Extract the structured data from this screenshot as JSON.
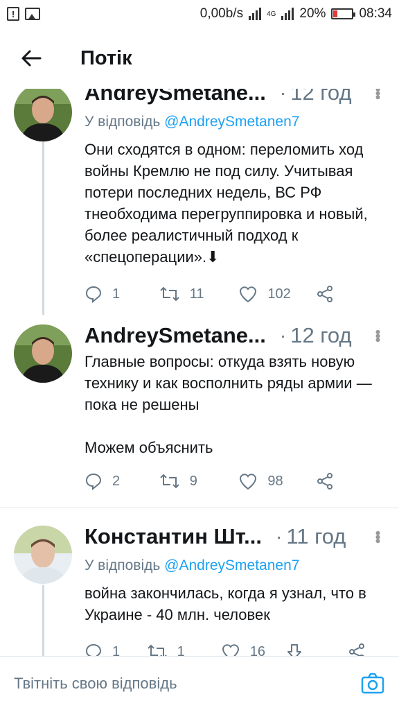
{
  "status_bar": {
    "speed": "0,00b/s",
    "network": "4G",
    "battery": "20%",
    "time": "08:34"
  },
  "header": {
    "title": "Потік"
  },
  "tweets": [
    {
      "name": "AndreySmetane...",
      "separator": "·",
      "time": "12 год",
      "reply_prefix": "У відповідь",
      "reply_handle": "@AndreySmetanen7",
      "text": "Они сходятся в одном: переломить ход войны Кремлю не под силу. Учитывая потери последних недель, ВС РФ тнеобходима перегруппировка и новый, более реалистичный подход к «спецоперации».⬇",
      "replies": "1",
      "retweets": "11",
      "likes": "102"
    },
    {
      "name": "AndreySmetane...",
      "separator": "·",
      "time": "12 год",
      "text": "Главные вопросы: откуда взять новую технику и как восполнить ряды армии — пока не решены\n\nМожем объяснить",
      "replies": "2",
      "retweets": "9",
      "likes": "98"
    },
    {
      "name": "Константин Шт...",
      "separator": "·",
      "time": "11 год",
      "reply_prefix": "У відповідь",
      "reply_handle": "@AndreySmetanen7",
      "text": "война закончилась, когда я узнал, что в Украине - 40 млн. человек",
      "replies": "1",
      "retweets": "1",
      "likes": "16"
    }
  ],
  "compose": {
    "placeholder": "Твітніть свою відповідь"
  },
  "colors": {
    "accent": "#1da1f2",
    "muted": "#657786",
    "divider": "#e1e8ed"
  }
}
